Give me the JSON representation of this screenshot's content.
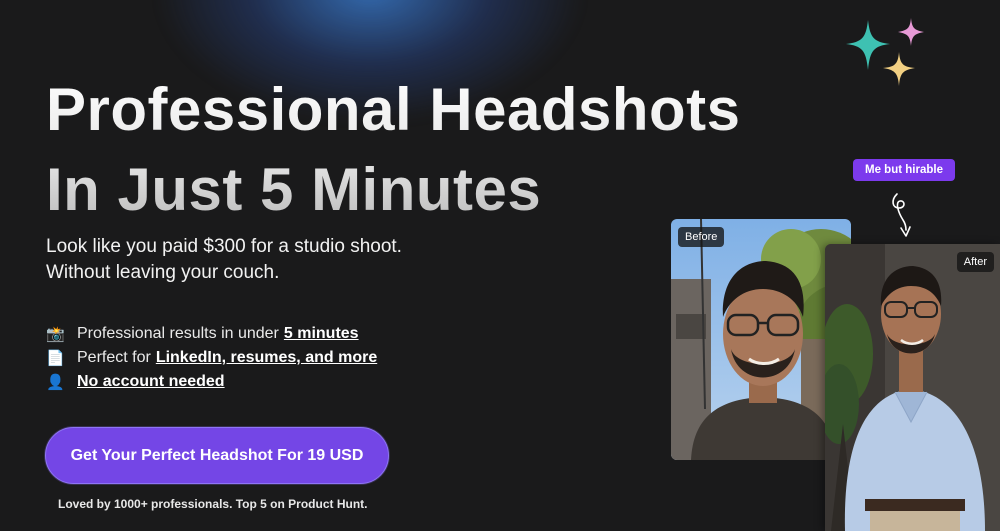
{
  "hero": {
    "headline_line1": "Professional Headshots",
    "headline_line2": "In Just 5 Minutes",
    "subtitle_line1": "Look like you paid $300 for a studio shoot.",
    "subtitle_line2": "Without leaving your couch."
  },
  "features": [
    {
      "icon": "camera-flash-icon",
      "emoji": "📸",
      "text": "Professional results in under",
      "highlight": "5 minutes"
    },
    {
      "icon": "document-icon",
      "emoji": "📄",
      "text": "Perfect for",
      "highlight": "LinkedIn, resumes, and more"
    },
    {
      "icon": "user-silhouette-icon",
      "emoji": "👤",
      "text": "",
      "highlight": "No account needed"
    }
  ],
  "cta": {
    "label": "Get Your Perfect Headshot For 19 USD"
  },
  "social_proof": "Loved by 1000+ professionals. Top 5 on Product Hunt.",
  "showcase": {
    "tag": "Me but hirable",
    "before_label": "Before",
    "after_label": "After"
  },
  "colors": {
    "background": "#1a1a1b",
    "accent": "#7446e6",
    "badge": "#7c3aed",
    "sparkle_teal": "#3ec1b2",
    "sparkle_pink": "#e79ad6",
    "sparkle_yellow": "#f2d083"
  }
}
